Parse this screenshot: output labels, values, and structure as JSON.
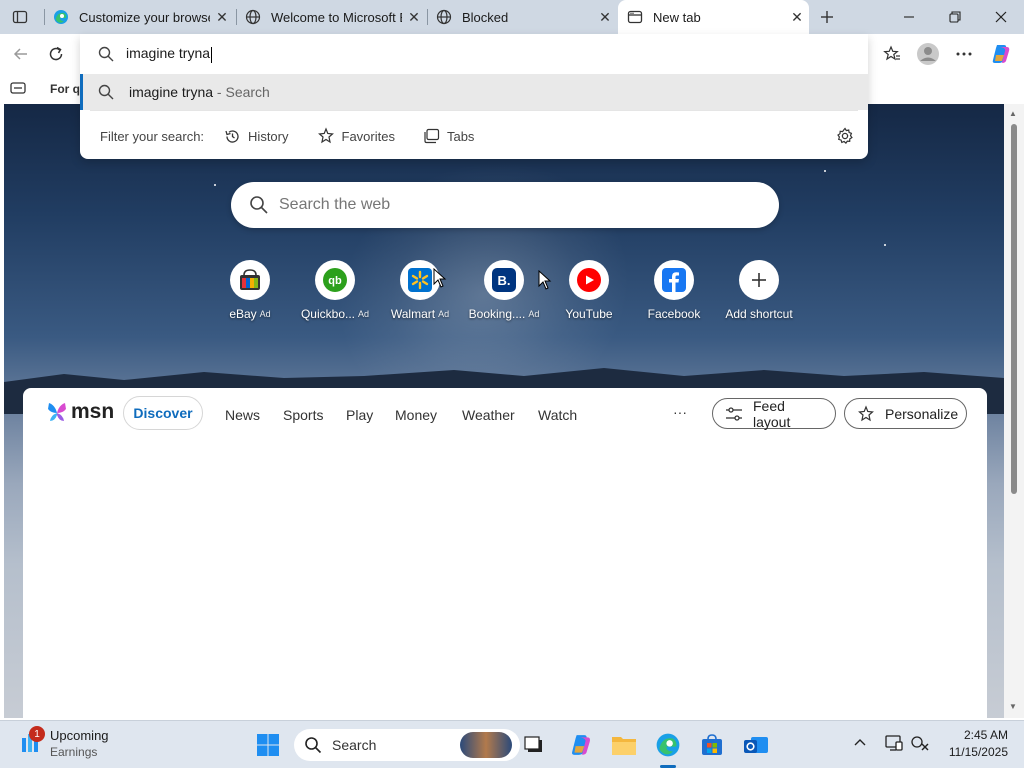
{
  "tabs": [
    {
      "label": "Customize your browser",
      "icon": "edge-icon"
    },
    {
      "label": "Welcome to Microsoft Ed",
      "icon": "globe-icon"
    },
    {
      "label": "Blocked",
      "icon": "globe-icon"
    },
    {
      "label": "New tab",
      "icon": "newtab-icon",
      "active": true
    }
  ],
  "favorites_bar": {
    "item": "For qu"
  },
  "address": {
    "value": "imagine tryna",
    "suggestion_query": "imagine tryna",
    "suggestion_action": " - Search",
    "filter_label": "Filter your search:",
    "filters": [
      "History",
      "Favorites",
      "Tabs"
    ]
  },
  "ntp": {
    "search_placeholder": "Search the web",
    "shortcuts": [
      {
        "label": "eBay",
        "ad": "Ad"
      },
      {
        "label": "Quickbo...",
        "ad": "Ad"
      },
      {
        "label": "Walmart",
        "ad": "Ad"
      },
      {
        "label": "Booking....",
        "ad": "Ad"
      },
      {
        "label": "YouTube",
        "ad": ""
      },
      {
        "label": "Facebook",
        "ad": ""
      },
      {
        "label": "Add shortcut",
        "ad": ""
      }
    ]
  },
  "msn": {
    "logo": "msn",
    "tabs": [
      "Discover",
      "News",
      "Sports",
      "Play",
      "Money",
      "Weather",
      "Watch"
    ],
    "more": "···",
    "feed_layout": "Feed layout",
    "personalize": "Personalize"
  },
  "taskbar": {
    "weather_title": "Upcoming",
    "weather_sub": "Earnings",
    "badge": "1",
    "search_label": "Search",
    "time": "2:45 AM",
    "date": "11/15/2025"
  },
  "colors": {
    "accent": "#0f6cbd",
    "youtube": "#ff0000",
    "facebook": "#1877f2",
    "quickbooks": "#2ca01c",
    "walmart": "#0071ce",
    "booking": "#003580"
  }
}
